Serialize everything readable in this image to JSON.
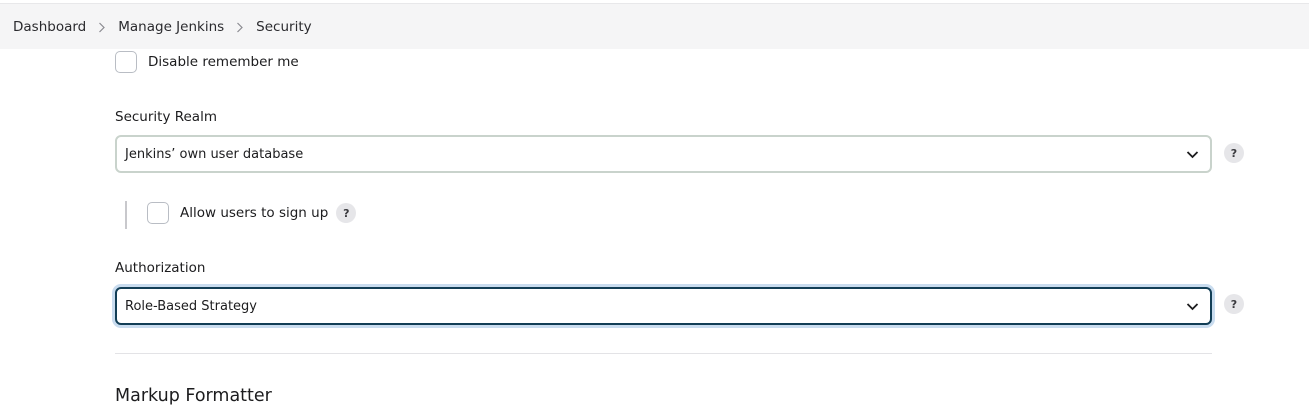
{
  "breadcrumb": {
    "items": [
      "Dashboard",
      "Manage Jenkins",
      "Security"
    ]
  },
  "disable_remember_me": {
    "label": "Disable remember me",
    "checked": false
  },
  "security_realm": {
    "label": "Security Realm",
    "value": "Jenkins’ own user database"
  },
  "allow_signup": {
    "label": "Allow users to sign up",
    "checked": false
  },
  "authorization": {
    "label": "Authorization",
    "value": "Role-Based Strategy"
  },
  "markup_formatter": {
    "title": "Markup Formatter"
  },
  "help_glyph": "?",
  "colors": {
    "focus_border": "#123e56",
    "focus_ring": "#c9dcef",
    "topbar_bg": "#f5f5f6"
  }
}
